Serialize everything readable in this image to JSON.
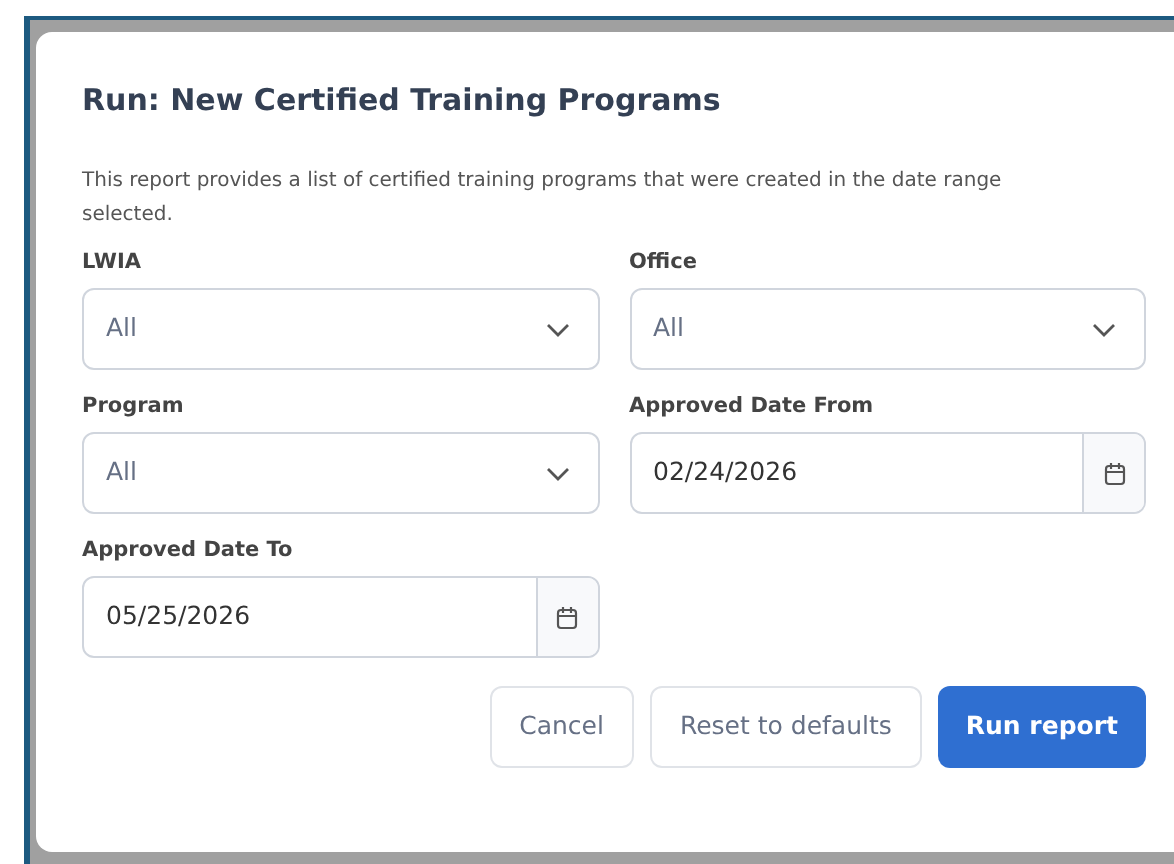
{
  "dialog": {
    "title": "Run: New Certified Training Programs",
    "description": "This report provides a list of certified training programs that were created in the date range selected."
  },
  "fields": [
    {
      "label": "LWIA",
      "kind": "select",
      "value": "All"
    },
    {
      "label": "Office",
      "kind": "select",
      "value": "All"
    },
    {
      "label": "Program",
      "kind": "select",
      "value": "All"
    },
    {
      "label": "Approved Date From",
      "kind": "date",
      "value": "02/24/2026"
    },
    {
      "label": "Approved Date To",
      "kind": "date",
      "value": "05/25/2026"
    }
  ],
  "buttons": [
    {
      "label": "Cancel",
      "kind": "secondary"
    },
    {
      "label": "Reset to defaults",
      "kind": "secondary"
    },
    {
      "label": "Run report",
      "kind": "primary"
    }
  ]
}
